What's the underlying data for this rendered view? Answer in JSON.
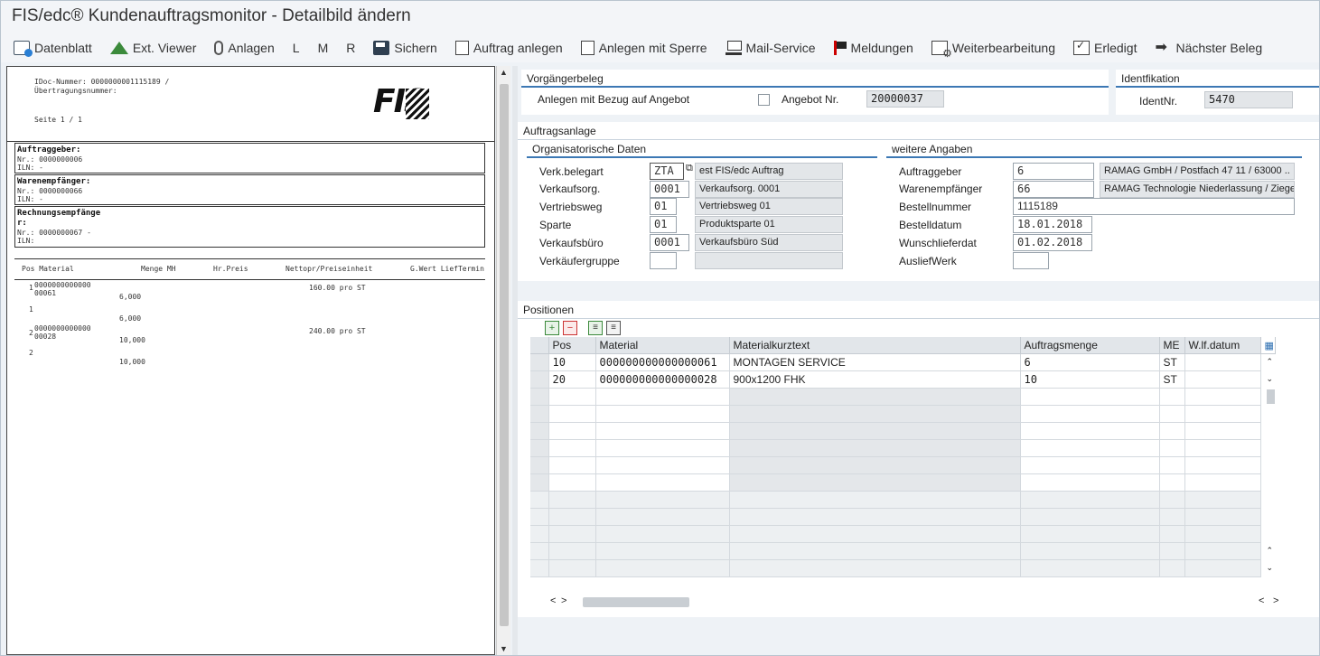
{
  "window": {
    "title": "FIS/edc® Kundenauftragsmonitor - Detailbild ändern"
  },
  "toolbar": {
    "datenblatt": "Datenblatt",
    "ext_viewer": "Ext. Viewer",
    "anlagen": "Anlagen",
    "l": "L",
    "m": "M",
    "r": "R",
    "sichern": "Sichern",
    "auftrag_anlegen": "Auftrag anlegen",
    "anlegen_mit_sperre": "Anlegen mit Sperre",
    "mail_service": "Mail-Service",
    "meldungen": "Meldungen",
    "weiterbearbeitung": "Weiterbearbeitung",
    "erledigt": "Erledigt",
    "naechster_beleg": "Nächster Beleg"
  },
  "preview": {
    "idoc_line": "IDoc-Nummer:  0000000001115189  /",
    "uebertragung_line": "Übertragungsnummer:",
    "seite_line": "Seite   1 / 1",
    "logo_text": "FIS",
    "auftraggeber_title": "Auftraggeber:",
    "auftraggeber_nr": "Nr.:  0000000006",
    "auftraggeber_iln": "ILN:                        -",
    "warenempfaenger_title": "Warenempfänger:",
    "warenempfaenger_nr": "Nr.:  0000000066",
    "warenempfaenger_iln": "ILN:                        -",
    "rechnungsempfaenger_title": "Rechnungsempfänge",
    "rechnungsempfaenger_title2": "r:",
    "rechnungsempfaenger_nr": "Nr.:  0000000067   -",
    "rechnungsempfaenger_iln": "ILN:",
    "col_headers": [
      "Pos Material",
      "Menge MH",
      "Hr.Preis",
      "Nettopr/Preiseinheit",
      "G.Wert LiefTermin"
    ],
    "rows": [
      {
        "pos": "1",
        "material": "0000000000000",
        "material2": "00061",
        "menge": "6,000",
        "preis": "160.00 pro ST"
      },
      {
        "pos": "1",
        "material": "",
        "material2": "",
        "menge": "6,000",
        "preis": ""
      },
      {
        "pos": "2",
        "material": "0000000000000",
        "material2": "00028",
        "menge": "10,000",
        "preis": "240.00 pro ST"
      },
      {
        "pos": "2",
        "material": "",
        "material2": "",
        "menge": "10,000",
        "preis": ""
      }
    ]
  },
  "vorgaengerbeleg": {
    "title": "Vorgängerbeleg",
    "anlegen_label": "Anlegen mit Bezug auf Angebot",
    "angebot_label": "Angebot Nr.",
    "angebot_value": "20000037"
  },
  "identifikation": {
    "title": "Identfikation",
    "ident_label": "IdentNr.",
    "ident_value": "5470"
  },
  "auftragsanlage": {
    "title": "Auftragsanlage",
    "org_title": "Organisatorische Daten",
    "verk_belegart_label": "Verk.belegart",
    "verk_belegart_value": "ZTA",
    "verk_belegart_text": "est FIS/edc Auftrag",
    "verkaufsorg_label": "Verkaufsorg.",
    "verkaufsorg_value": "0001",
    "verkaufsorg_text": "Verkaufsorg. 0001",
    "vertriebsweg_label": "Vertriebsweg",
    "vertriebsweg_value": "01",
    "vertriebsweg_text": "Vertriebsweg 01",
    "sparte_label": "Sparte",
    "sparte_value": "01",
    "sparte_text": "Produktsparte 01",
    "verkaufsbuero_label": "Verkaufsbüro",
    "verkaufsbuero_value": "0001",
    "verkaufsbuero_text": "Verkaufsbüro Süd",
    "verkaeufergruppe_label": "Verkäufergruppe",
    "weitere_title": "weitere Angaben",
    "auftraggeber_label": "Auftraggeber",
    "auftraggeber_value": "6",
    "auftraggeber_text": "RAMAG GmbH / Postfach 47 11 / 63000 ..",
    "warenempfaenger_label": "Warenempfänger",
    "warenempfaenger_value": "66",
    "warenempfaenger_text": "RAMAG Technologie Niederlassung / Ziegel..",
    "bestellnummer_label": "Bestellnummer",
    "bestellnummer_value": "1115189",
    "bestelldatum_label": "Bestelldatum",
    "bestelldatum_value": "18.01.2018",
    "wunschlieferdat_label": "Wunschlieferdat",
    "wunschlieferdat_value": "01.02.2018",
    "auslieferwerk_label": "AusliefWerk"
  },
  "positionen": {
    "title": "Positionen",
    "columns": [
      "Pos",
      "Material",
      "Materialkurztext",
      "Auftragsmenge",
      "ME",
      "W.lf.datum"
    ],
    "rows": [
      {
        "pos": "10",
        "material": "000000000000000061",
        "text": "MONTAGEN SERVICE",
        "menge": "6",
        "me": "ST"
      },
      {
        "pos": "20",
        "material": "000000000000000028",
        "text": "900x1200 FHK",
        "menge": "10",
        "me": "ST"
      }
    ]
  },
  "colors": {
    "accent": "#3c78b4",
    "panel": "#eef2f6"
  }
}
